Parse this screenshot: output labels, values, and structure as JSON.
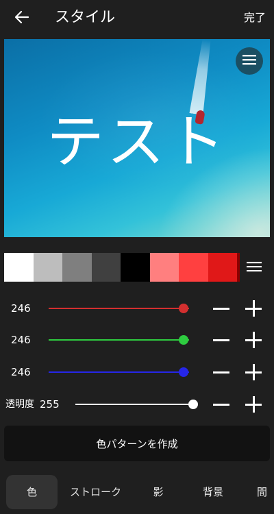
{
  "header": {
    "title": "スタイル",
    "done_label": "完了"
  },
  "preview": {
    "text": "テスト"
  },
  "palette": {
    "swatches": [
      "#ffffff",
      "#bdbdbd",
      "#7f7f7f",
      "#404040",
      "#000000",
      "#ff7f7f",
      "#ff4040",
      "#e01818"
    ],
    "accent_edge": "#8c0000"
  },
  "sliders": {
    "red": {
      "value": "246",
      "color": "#d32f2f",
      "level": 0.96
    },
    "green": {
      "value": "246",
      "color": "#2ecc40",
      "level": 0.96
    },
    "blue": {
      "value": "246",
      "color": "#2626e8",
      "level": 0.96
    },
    "opacity": {
      "label": "透明度",
      "value": "255",
      "color": "#ffffff",
      "level": 1.0
    }
  },
  "create_button": {
    "label": "色パターンを作成"
  },
  "tabs": [
    {
      "label": "色",
      "active": true
    },
    {
      "label": "ストローク",
      "active": false
    },
    {
      "label": "影",
      "active": false
    },
    {
      "label": "背景",
      "active": false
    },
    {
      "label": "間",
      "active": false
    }
  ]
}
